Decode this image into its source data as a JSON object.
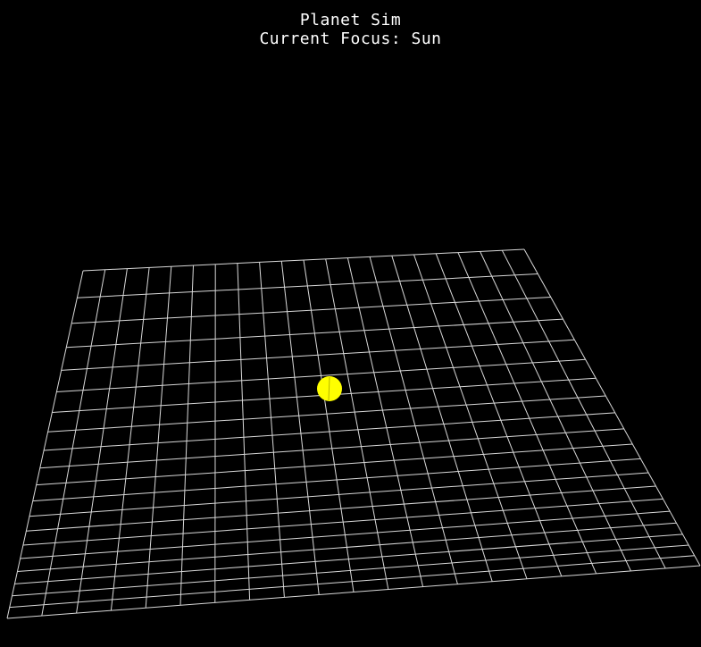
{
  "hud": {
    "title": "Planet Sim",
    "focus_label": "Current Focus: Sun"
  },
  "scene": {
    "grid_divisions": 20,
    "grid_color": "#d8d8d8",
    "background_color": "#000000",
    "bodies": [
      {
        "name": "Sun",
        "color": "#ffff00"
      }
    ]
  }
}
